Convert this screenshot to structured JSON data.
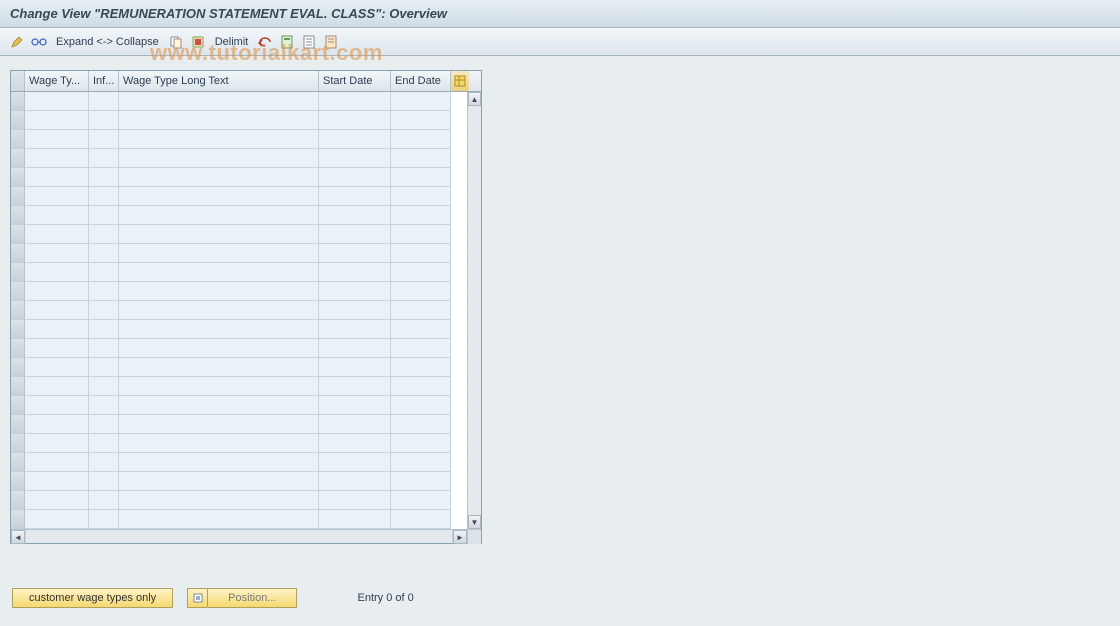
{
  "title": "Change View \"REMUNERATION STATEMENT EVAL. CLASS\": Overview",
  "watermark": "www.tutorialkart.com",
  "toolbar": {
    "expand_label": "Expand <-> Collapse",
    "delimit_label": "Delimit"
  },
  "grid": {
    "columns": {
      "wage_type": "Wage Ty...",
      "inf": "Inf...",
      "long_text": "Wage Type Long Text",
      "start": "Start Date",
      "end": "End Date"
    },
    "row_count": 23
  },
  "footer": {
    "customer_wage_btn": "customer wage types only",
    "position_btn": "Position...",
    "entry_text": "Entry 0 of 0"
  }
}
